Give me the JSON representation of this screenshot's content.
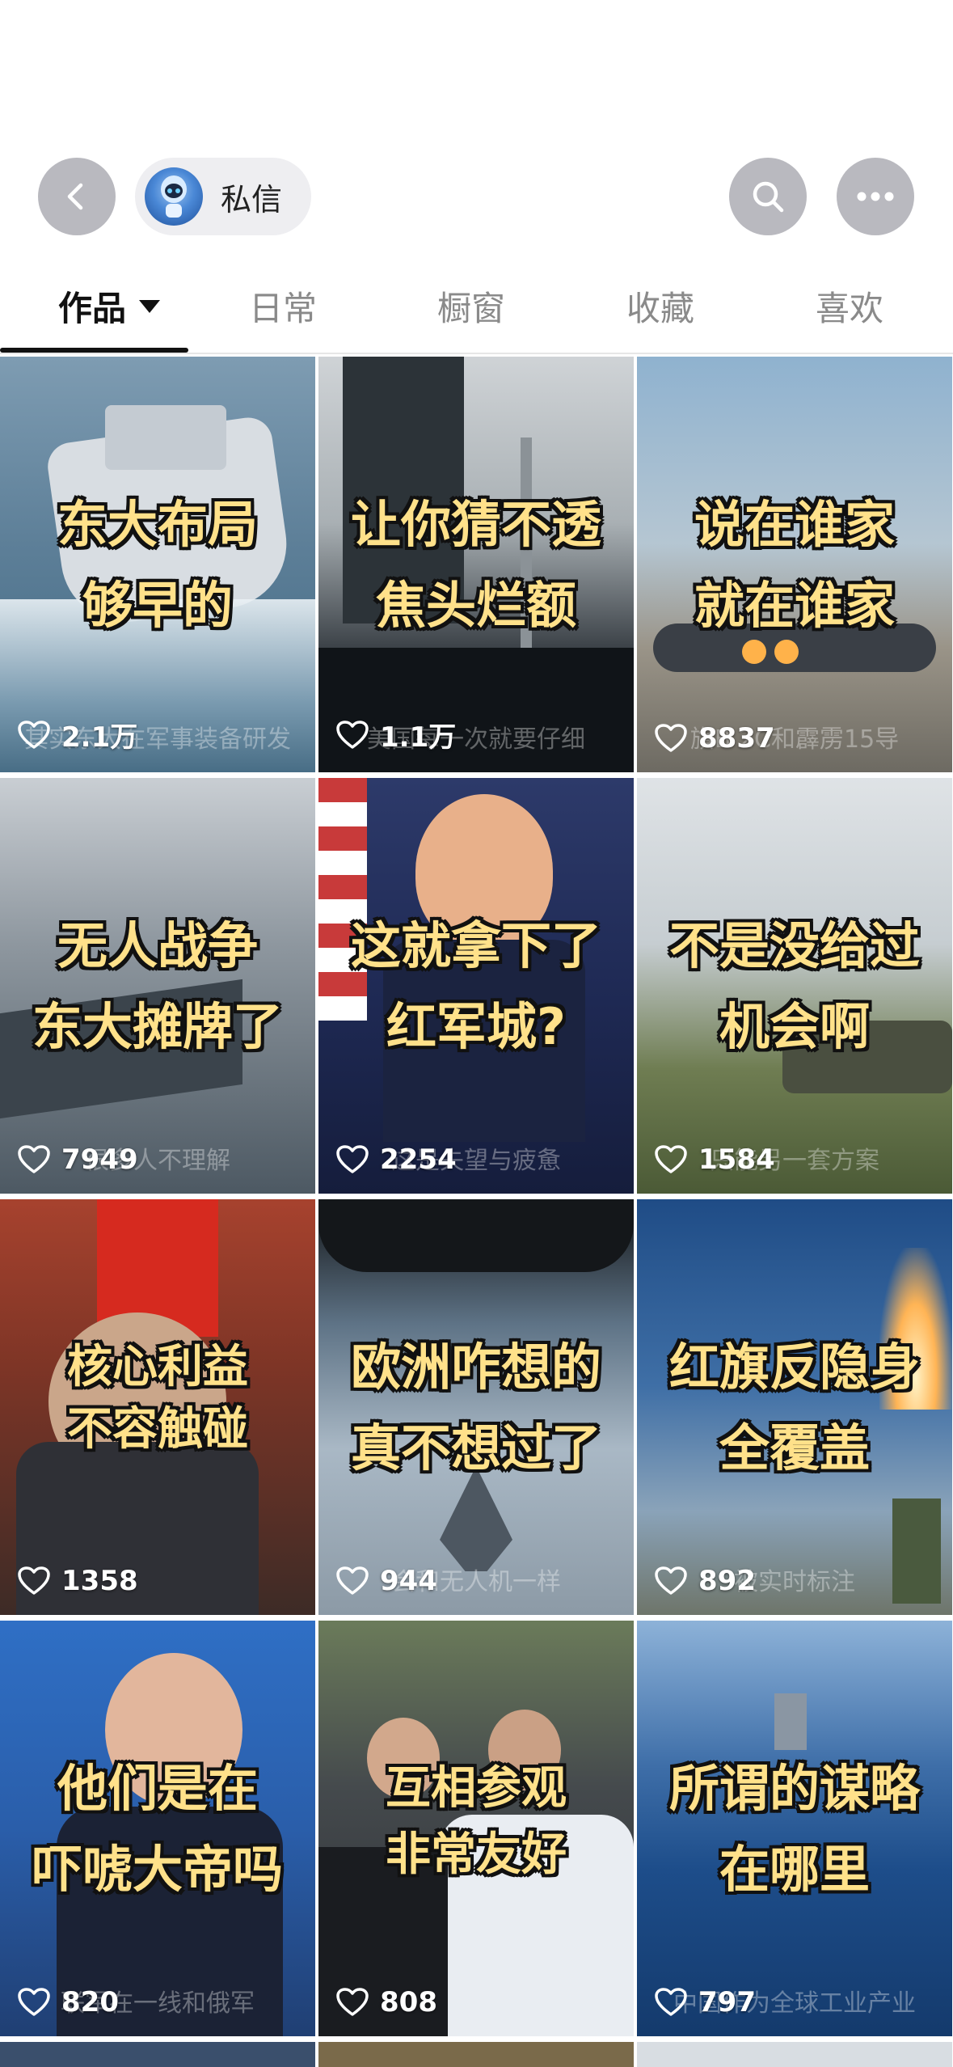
{
  "header": {
    "dm_label": "私信",
    "icons": {
      "back": "chevron-left-icon",
      "search": "search-icon",
      "more": "more-horizontal-icon"
    }
  },
  "tabs": [
    {
      "label": "作品",
      "active": true
    },
    {
      "label": "日常",
      "active": false
    },
    {
      "label": "橱窗",
      "active": false
    },
    {
      "label": "收藏",
      "active": false
    },
    {
      "label": "喜欢",
      "active": false
    }
  ],
  "videos": [
    {
      "caption1": "东大布局",
      "caption2": "够早的",
      "likes": "2.1万",
      "subtitle": "其实东大在军事装备研发"
    },
    {
      "caption1": "让你猜不透",
      "caption2": "焦头烂额",
      "likes": "1.1万",
      "subtitle": "美国每一次就要仔细"
    },
    {
      "caption1": "说在谁家",
      "caption2": "就在谁家",
      "likes": "8837",
      "subtitle": "旗B 2C和霹雳15导"
    },
    {
      "caption1": "无人战争",
      "caption2": "东大摊牌了",
      "likes": "7949",
      "subtitle": "很多人不理解"
    },
    {
      "caption1": "这就拿下了",
      "caption2": "红军城?",
      "likes": "2254",
      "subtitle": "这是失望与疲惫"
    },
    {
      "caption1": "不是没给过",
      "caption2": "机会啊",
      "likes": "1584",
      "subtitle": "只能另一套方案"
    },
    {
      "caption1": "核心利益",
      "caption2": "不容触碰",
      "likes": "1358",
      "subtitle": ""
    },
    {
      "caption1": "欧洲咋想的",
      "caption2": "真不想过了",
      "likes": "944",
      "subtitle": "会和无人机一样"
    },
    {
      "caption1": "红旗反隐身",
      "caption2": "全覆盖",
      "likes": "892",
      "subtitle": "被实时标注"
    },
    {
      "caption1": "他们是在",
      "caption2": "吓唬大帝吗",
      "likes": "820",
      "subtitle": "联军在一线和俄军"
    },
    {
      "caption1": "互相参观",
      "caption2": "非常友好",
      "likes": "808",
      "subtitle": ""
    },
    {
      "caption1": "所谓的谋略",
      "caption2": "在哪里",
      "likes": "797",
      "subtitle": "中国作为全球工业产业"
    }
  ],
  "colors": {
    "caption_text": "#ffe18a",
    "button_bg": "#b9b9bf",
    "pill_bg": "#eeeef1"
  }
}
